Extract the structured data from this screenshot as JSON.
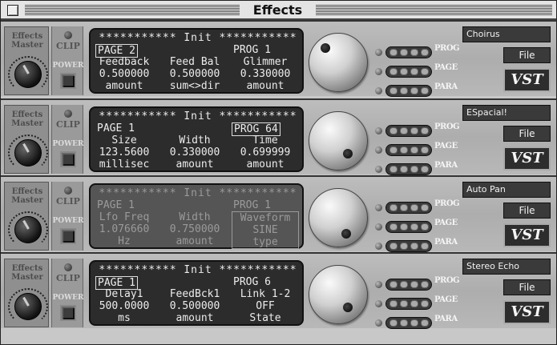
{
  "window": {
    "title": "Effects"
  },
  "plugins": [
    {
      "power_label": "POWER",
      "clip_label": "CLIP",
      "master_label": "Effects Master",
      "lcd": {
        "header": "*********** Init ***********",
        "page": "PAGE 2",
        "prog": "PROG 1",
        "page_boxed": true,
        "prog_boxed": false,
        "columns": [
          {
            "name": "Feedback",
            "value": "0.500000",
            "unit": "amount"
          },
          {
            "name": "Feed Bal",
            "value": "0.500000",
            "unit": "sum<>dir"
          },
          {
            "name": "Glimmer",
            "value": "0.330000",
            "unit": "amount"
          }
        ]
      },
      "rows": [
        "PROG",
        "PAGE",
        "PARA"
      ],
      "preset_name": "Choirus",
      "file_label": "File",
      "logo": "VST"
    },
    {
      "power_label": "POWER",
      "clip_label": "CLIP",
      "master_label": "Effects Master",
      "lcd": {
        "header": "*********** Init ***********",
        "page": "PAGE 1",
        "prog": "PROG 64",
        "page_boxed": false,
        "prog_boxed": true,
        "columns": [
          {
            "name": "Size",
            "value": "123.5600",
            "unit": "millisec"
          },
          {
            "name": "Width",
            "value": "0.330000",
            "unit": "amount"
          },
          {
            "name": "Time",
            "value": "0.699999",
            "unit": "amount"
          }
        ]
      },
      "rows": [
        "PROG",
        "PAGE",
        "PARA"
      ],
      "preset_name": "ESpacial!",
      "file_label": "File",
      "logo": "VST"
    },
    {
      "power_label": "POWER",
      "clip_label": "CLIP",
      "master_label": "Effects Master",
      "lcd": {
        "header": "*********** Init ***********",
        "page": "PAGE 1",
        "prog": "PROG 1",
        "page_boxed": false,
        "prog_boxed": false,
        "columns": [
          {
            "name": "Lfo Freq",
            "value": "1.076660",
            "unit": "Hz"
          },
          {
            "name": "Width",
            "value": "0.750000",
            "unit": "amount"
          },
          {
            "name": "Waveform",
            "value": "SINE",
            "unit": "type"
          }
        ]
      },
      "rows": [
        "PROG",
        "PAGE",
        "PARA"
      ],
      "preset_name": "Auto Pan",
      "file_label": "File",
      "logo": "VST"
    },
    {
      "power_label": "POWER",
      "clip_label": "CLIP",
      "master_label": "Effects Master",
      "lcd": {
        "header": "*********** Init ***********",
        "page": "PAGE 1",
        "prog": "PROG 6",
        "page_boxed": true,
        "prog_boxed": false,
        "columns": [
          {
            "name": "Delay1",
            "value": "500.0000",
            "unit": "ms"
          },
          {
            "name": "FeedBck1",
            "value": "0.500000",
            "unit": "amount"
          },
          {
            "name": "Link 1-2",
            "value": "OFF",
            "unit": "State"
          }
        ]
      },
      "rows": [
        "PROG",
        "PAGE",
        "PARA"
      ],
      "preset_name": "Stereo Echo",
      "file_label": "File",
      "logo": "VST"
    }
  ]
}
